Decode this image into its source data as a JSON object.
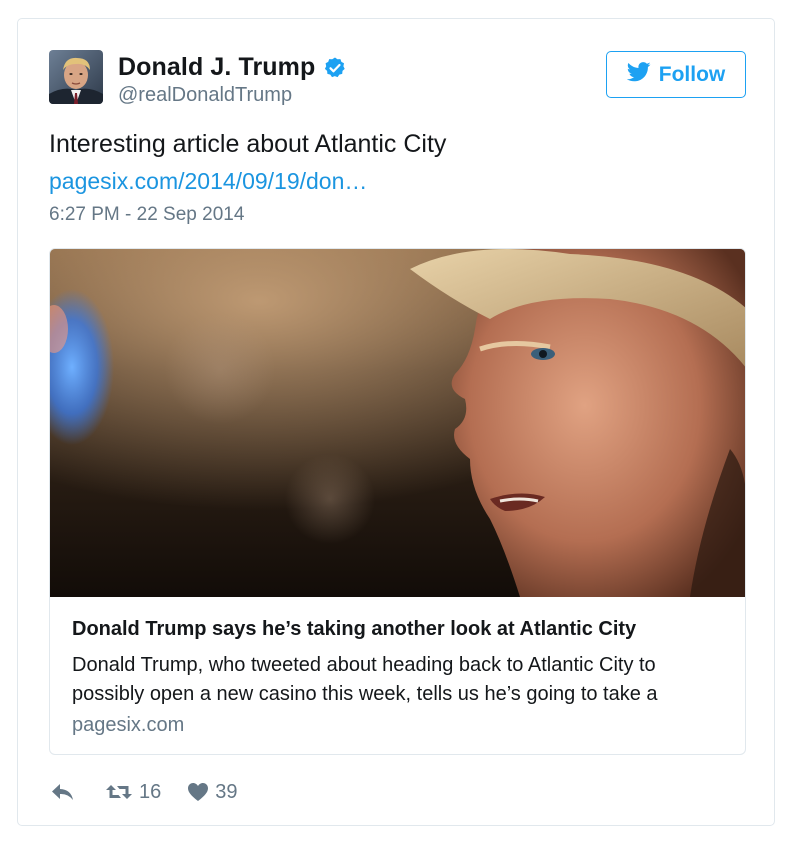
{
  "author": {
    "display_name": "Donald J. Trump",
    "handle": "@realDonaldTrump",
    "verified": true,
    "avatar": "profile-photo"
  },
  "follow_button": {
    "label": "Follow",
    "icon": "twitter-bird-icon"
  },
  "tweet": {
    "text": "Interesting article about Atlantic City",
    "link_text": "pagesix.com/2014/09/19/don…",
    "timestamp": "6:27 PM - 22 Sep 2014"
  },
  "card": {
    "image": "news-photo",
    "title": "Donald Trump says he’s taking another look at Atlantic City",
    "description": "Donald Trump, who tweeted about heading back to Atlantic City to possibly open a new casino this week, tells us he’s going to take a",
    "domain": "pagesix.com"
  },
  "actions": {
    "reply": {
      "icon": "reply-icon"
    },
    "retweet": {
      "icon": "retweet-icon",
      "count": "16"
    },
    "like": {
      "icon": "heart-icon",
      "count": "39"
    }
  },
  "colors": {
    "accent": "#1da1f2",
    "link": "#1b95e0",
    "secondary_text": "#657786",
    "border": "#e1e8ed"
  }
}
